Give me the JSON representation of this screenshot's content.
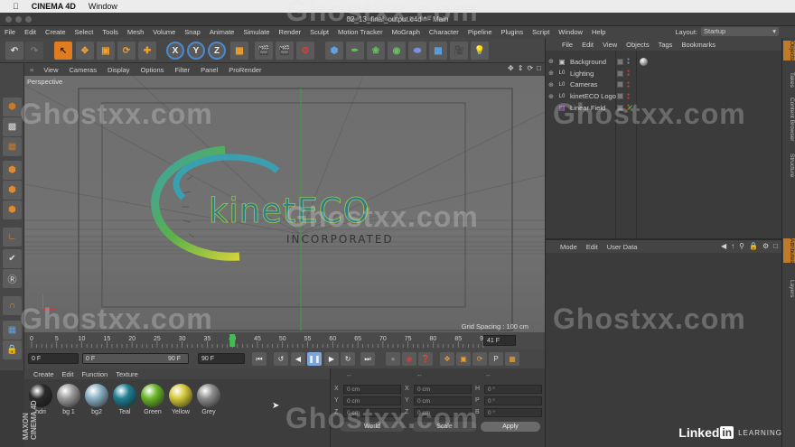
{
  "mac_menu": {
    "app": "CINEMA 4D",
    "window": "Window"
  },
  "window_title": "02_13_final_output.c4d * - Main",
  "menubar": [
    "File",
    "Edit",
    "Create",
    "Select",
    "Tools",
    "Mesh",
    "Volume",
    "Snap",
    "Animate",
    "Simulate",
    "Render",
    "Sculpt",
    "Motion Tracker",
    "MoGraph",
    "Character",
    "Pipeline",
    "Plugins",
    "Script",
    "Window",
    "Help"
  ],
  "layout": {
    "label": "Layout:",
    "value": "Startup"
  },
  "viewport": {
    "menu": [
      "View",
      "Cameras",
      "Display",
      "Options",
      "Filter",
      "Panel",
      "ProRender"
    ],
    "label": "Perspective",
    "grid_spacing": "Grid Spacing : 100 cm",
    "logo_main": "kinetECO",
    "logo_sub": "INCORPORATED"
  },
  "timeline": {
    "ticks": [
      "0",
      "5",
      "10",
      "15",
      "20",
      "25",
      "30",
      "35",
      "40",
      "45",
      "50",
      "55",
      "60",
      "65",
      "70",
      "75",
      "80",
      "85",
      "90"
    ],
    "current_frame": 40,
    "current_frame_label": "41 F",
    "max_frame": 90
  },
  "transport": {
    "start": "0 F",
    "range_start": "0 F",
    "range_end": "90 F",
    "end": "90 F"
  },
  "materials": {
    "menu": [
      "Create",
      "Edit",
      "Function",
      "Texture"
    ],
    "items": [
      {
        "name": "hdri",
        "color": "#2a2a2a"
      },
      {
        "name": "bg 1",
        "color": "#9a9a9a"
      },
      {
        "name": "bg2",
        "color": "#8ab0c4"
      },
      {
        "name": "Teal",
        "color": "#1f7f93"
      },
      {
        "name": "Green",
        "color": "#6bb52a"
      },
      {
        "name": "Yellow",
        "color": "#d4c83a"
      },
      {
        "name": "Grey",
        "color": "#8c8c8c"
      }
    ],
    "brand": "MAXON CINEMA 4D"
  },
  "coordinates": {
    "header": [
      "--",
      "--",
      "--"
    ],
    "rows": [
      {
        "a": "X",
        "av": "0 cm",
        "b": "X",
        "bv": "0 cm",
        "c": "H",
        "cv": "0 °"
      },
      {
        "a": "Y",
        "av": "0 cm",
        "b": "Y",
        "bv": "0 cm",
        "c": "P",
        "cv": "0 °"
      },
      {
        "a": "Z",
        "av": "0 cm",
        "b": "Z",
        "bv": "0 cm",
        "c": "B",
        "cv": "0 °"
      }
    ],
    "world": "World",
    "scale": "Scale",
    "apply": "Apply"
  },
  "objects": {
    "menu": [
      "File",
      "Edit",
      "View",
      "Objects",
      "Tags",
      "Bookmarks"
    ],
    "items": [
      {
        "name": "Background",
        "icon": "background-icon"
      },
      {
        "name": "Lighting",
        "icon": "null-icon"
      },
      {
        "name": "Cameras",
        "icon": "null-icon"
      },
      {
        "name": "kinetECO Logo",
        "icon": "null-icon"
      },
      {
        "name": "Linear Field",
        "icon": "field-icon"
      }
    ]
  },
  "attributes": {
    "menu": [
      "Mode",
      "Edit",
      "User Data"
    ]
  },
  "right_tabs": [
    "Objects",
    "Takes",
    "Content Browser",
    "Structure",
    "Attributes",
    "Layers"
  ],
  "watermark": "Ghostxx.com",
  "linkedin": {
    "brand": "Linked",
    "in": "in",
    "suffix": "LEARNING"
  }
}
